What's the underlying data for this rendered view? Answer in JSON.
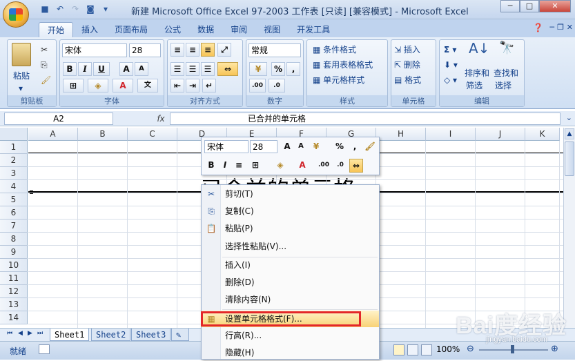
{
  "window": {
    "title": "新建 Microsoft Office Excel 97-2003 工作表 [只读] [兼容模式] - Microsoft Excel",
    "minimize": "─",
    "maximize": "□",
    "close": "✕"
  },
  "tabs": [
    "开始",
    "插入",
    "页面布局",
    "公式",
    "数据",
    "审阅",
    "视图",
    "开发工具"
  ],
  "ribbon": {
    "clipboard": {
      "label": "剪贴板",
      "paste": "粘贴"
    },
    "font": {
      "label": "字体",
      "name": "宋体",
      "size": "28"
    },
    "alignment": {
      "label": "对齐方式"
    },
    "number": {
      "label": "数字",
      "format": "常规"
    },
    "styles": {
      "label": "样式",
      "cond": "条件格式",
      "table": "套用表格格式",
      "cell": "单元格样式"
    },
    "cells": {
      "label": "单元格",
      "insert": "插入",
      "delete": "删除",
      "format": "格式"
    },
    "editing": {
      "label": "编辑",
      "sort": "排序和",
      "sort2": "筛选",
      "find": "查找和",
      "find2": "选择"
    }
  },
  "formula": {
    "namebox": "A2",
    "fx": "fx",
    "content": "已合并的单元格"
  },
  "grid": {
    "columns": [
      "A",
      "B",
      "C",
      "D",
      "E",
      "F",
      "G",
      "H",
      "I",
      "J",
      "K"
    ],
    "rows": [
      "1",
      "2",
      "3",
      "4",
      "5",
      "6",
      "7",
      "8",
      "9",
      "10",
      "11",
      "12",
      "13",
      "14"
    ],
    "merged_text": "已合并的单元格"
  },
  "mini_toolbar": {
    "font": "宋体",
    "size": "28"
  },
  "context_menu": {
    "items": [
      "剪切(T)",
      "复制(C)",
      "粘贴(P)",
      "选择性粘贴(V)...",
      "插入(I)",
      "删除(D)",
      "清除内容(N)",
      "设置单元格格式(F)...",
      "行高(R)...",
      "隐藏(H)"
    ],
    "icons": [
      "scissors-icon",
      "copy-icon",
      "paste-icon",
      "",
      "",
      "",
      "",
      "format-cells-icon",
      "",
      ""
    ]
  },
  "sheets": [
    "Sheet1",
    "Sheet2",
    "Sheet3"
  ],
  "status": {
    "ready": "就绪",
    "zoom": "100%"
  },
  "watermark": {
    "main": "Bai度经验",
    "sub": "jingyan.baidu.com"
  },
  "colors": {
    "highlight_border": "#e3262a",
    "ribbon_bg": "#dae6f5"
  }
}
